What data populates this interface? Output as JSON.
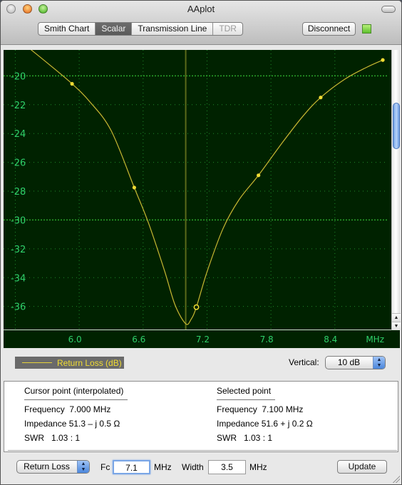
{
  "window": {
    "title": "AAplot"
  },
  "toolbar": {
    "tabs": [
      {
        "label": "Smith Chart",
        "state": "normal"
      },
      {
        "label": "Scalar",
        "state": "active"
      },
      {
        "label": "Transmission Line",
        "state": "normal"
      },
      {
        "label": "TDR",
        "state": "disabled"
      }
    ],
    "disconnect_label": "Disconnect",
    "connection_status": "connected",
    "status_color": "#5ec12d"
  },
  "chart_data": {
    "type": "line",
    "title": "",
    "xlabel": "MHz",
    "ylabel": "",
    "x_ticks": [
      6.0,
      6.6,
      7.2,
      7.8,
      8.4
    ],
    "x_tick_labels": [
      "6.0",
      "6.6",
      "7.2",
      "7.8",
      "8.4"
    ],
    "y_ticks": [
      -20,
      -22,
      -24,
      -26,
      -28,
      -30,
      -32,
      -34,
      -36
    ],
    "y_tick_labels": [
      "-20",
      "-22",
      "-24",
      "-26",
      "-28",
      "-30",
      "-32",
      "-34",
      "-36"
    ],
    "xlim": [
      5.29,
      8.93
    ],
    "ylim": [
      -37.6,
      -18.2
    ],
    "grid": true,
    "cursor_x": 7.0,
    "selected_point": {
      "x": 7.1,
      "y": -36.05
    },
    "series": [
      {
        "name": "Return Loss (dB)",
        "color": "#c8b832",
        "points": [
          {
            "x": 5.35,
            "y": -17.0
          },
          {
            "x": 5.933,
            "y": -20.55
          },
          {
            "x": 6.517,
            "y": -27.75
          },
          {
            "x": 7.1,
            "y": -36.05
          },
          {
            "x": 7.683,
            "y": -26.9
          },
          {
            "x": 8.267,
            "y": -21.5
          },
          {
            "x": 8.85,
            "y": -18.9
          }
        ],
        "curve": [
          [
            5.35,
            -17.0
          ],
          [
            5.5,
            -17.9
          ],
          [
            5.7,
            -19.1
          ],
          [
            5.933,
            -20.55
          ],
          [
            6.1,
            -21.8
          ],
          [
            6.3,
            -23.8
          ],
          [
            6.517,
            -27.75
          ],
          [
            6.65,
            -30.2
          ],
          [
            6.8,
            -33.5
          ],
          [
            6.9,
            -35.9
          ],
          [
            7.0,
            -37.2
          ],
          [
            7.05,
            -36.9
          ],
          [
            7.1,
            -36.05
          ],
          [
            7.2,
            -33.6
          ],
          [
            7.35,
            -30.6
          ],
          [
            7.5,
            -28.6
          ],
          [
            7.683,
            -26.9
          ],
          [
            7.9,
            -24.7
          ],
          [
            8.1,
            -22.8
          ],
          [
            8.267,
            -21.5
          ],
          [
            8.5,
            -20.2
          ],
          [
            8.7,
            -19.4
          ],
          [
            8.85,
            -18.9
          ]
        ]
      }
    ]
  },
  "legend": {
    "label": "Return Loss (dB)",
    "line_color": "#e6d23a",
    "text_color": "#f1dc33"
  },
  "vertical": {
    "label": "Vertical:",
    "value": "10 dB"
  },
  "info": {
    "cursor": {
      "heading": "Cursor point (interpolated)",
      "frequency": "Frequency  7.000 MHz",
      "impedance": "Impedance 51.3 – j 0.5 Ω",
      "swr": "SWR   1.03 : 1"
    },
    "selected": {
      "heading": "Selected point",
      "frequency": "Frequency  7.100 MHz",
      "impedance": "Impedance 51.6 + j 0.2 Ω",
      "swr": "SWR   1.03 : 1"
    }
  },
  "controls": {
    "mode_value": "Return Loss",
    "fc_label": "Fc",
    "fc_value": "7.1",
    "fc_unit": "MHz",
    "width_label": "Width",
    "width_value": "3.5",
    "width_unit": "MHz",
    "update_label": "Update"
  },
  "icons": {
    "scroll_up": "▲",
    "scroll_down": "▼",
    "select_arrows": "▲▼"
  }
}
